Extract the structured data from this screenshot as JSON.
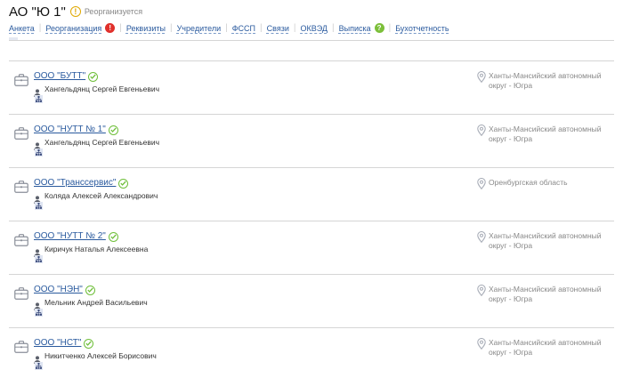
{
  "company": {
    "title": "АО \"Ю 1\"",
    "status": "Реорганизуется",
    "status_icon": "warning-icon"
  },
  "tabs": [
    {
      "label": "Анкета"
    },
    {
      "label": "Реорганизация",
      "badge": "!"
    },
    {
      "label": "Реквизиты"
    },
    {
      "label": "Учредители"
    },
    {
      "label": "ФССП"
    },
    {
      "label": "Связи"
    },
    {
      "label": "ОКВЭД"
    },
    {
      "label": "Выписка",
      "badge": "?"
    },
    {
      "label": "Бухотчетность"
    }
  ],
  "colors": {
    "link": "#2a5a9e",
    "badge_red": "#e0302b",
    "badge_green": "#7cbf3a",
    "check": "#6fbf3a",
    "muted": "#888888"
  },
  "organizations": [
    {
      "name": "ООО \"БУТТ\"",
      "person": "Хангельдянц Сергей Евгеньевич",
      "region": "Ханты-Мансийский автономный округ - Югра"
    },
    {
      "name": "ООО \"НУТТ № 1\"",
      "person": "Хангельдянц Сергей Евгеньевич",
      "region": "Ханты-Мансийский автономный округ - Югра"
    },
    {
      "name": "ООО \"Транссервис\"",
      "person": "Коляда Алексей Александрович",
      "region": "Оренбургская область"
    },
    {
      "name": "ООО \"НУТТ № 2\"",
      "person": "Киричук Наталья Алексеевна",
      "region": "Ханты-Мансийский автономный округ - Югра"
    },
    {
      "name": "ООО \"НЭН\"",
      "person": "Мельник Андрей Васильевич",
      "region": "Ханты-Мансийский автономный округ - Югра"
    },
    {
      "name": "ООО \"НСТ\"",
      "person": "Никитченко Алексей Борисович",
      "region": "Ханты-Мансийский автономный округ - Югра"
    }
  ]
}
